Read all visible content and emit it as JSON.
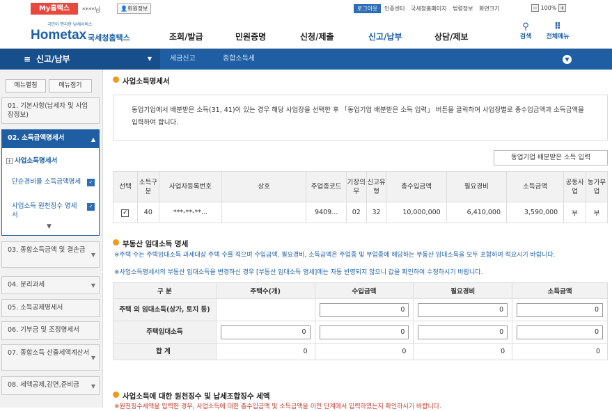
{
  "top": {
    "my_hometax": "My홈택스",
    "user_name": "****님",
    "user_info": "회원정보",
    "logout": "로그아웃",
    "links": [
      "인증센터",
      "국세청홈페이지",
      "법령정보",
      "화면크기"
    ],
    "zoom": "100%"
  },
  "header": {
    "logo_small": "국민이 편리한 납세서비스",
    "logo_en": "Hometax",
    "logo_ko": "국세청홈택스",
    "nav": [
      "조회/발급",
      "민원증명",
      "신청/제출",
      "신고/납부",
      "상담/제보"
    ],
    "search": "검색",
    "all_menu": "전체메뉴"
  },
  "locbar": {
    "title": "신고/납부",
    "crumb1": "세금신고",
    "crumb2": "종합소득세"
  },
  "side": {
    "edit_btn": "메뉴펼침",
    "fold_btn": "메뉴접기",
    "items": [
      "01. 기본사항(납세자 및 사업장정보)",
      "02. 소득금액명세서",
      "03. 종합소득금액 및 결손금",
      "04. 분리과세",
      "05. 소득공제명세서",
      "06. 기부금 및 조정명세서",
      "07. 종합소득 산출세액계산서",
      "08. 세액공제,감면,준비금"
    ],
    "sub_title": "사업소득명세서",
    "sub_items": [
      "단순경비율 소득금액명세",
      "사업소득 원천징수 명세서"
    ]
  },
  "main": {
    "sec1_title": "사업소득명세서",
    "notice": "동업기업에서 배분받은 소득(31, 41)이 있는 경우 해당 사업장을 선택한 후 「동업기업 배분받은 소득 입력」 버튼을 클릭하여 사업장별로 총수입금액과 소득금액을 입력하여 합니다.",
    "input_btn": "동업기업 배분받은 소득 입력",
    "t1_headers": [
      "선택",
      "소득구분",
      "사업자등록번호",
      "상호",
      "주업종코드",
      "기장의무",
      "신고유형",
      "총수입금액",
      "필요경비",
      "소득금액",
      "공동사업",
      "농가부업"
    ],
    "t1_row": {
      "code": "40",
      "bizno": "***-**-**...",
      "name": "",
      "industry": "9409...",
      "duty": "02",
      "type": "32",
      "revenue": "10,000,000",
      "expense": "6,410,000",
      "income": "3,590,000",
      "joint": "부",
      "farm": "부"
    },
    "sec2_title": "부동산 임대소득 명세",
    "note1": "※주택 수는 주택임대소득 과세대상 주택 수를 적으며 수입금액, 필요경비, 소득금액은 주업종 및 부업종에 해당하는 부동산 임대소득을 모두 포함하여 적요시기 바랍니다.",
    "note2": "※사업소득명세서의 부동산 임대소득을 변경하신 경우 [부동산 임대소득 명세]에는 자동 반영되지 않으니 값을 확인하여 수정하시기 바랍니다.",
    "t2_headers": [
      "구 분",
      "주택수(개)",
      "수입금액",
      "필요경비",
      "소득금액"
    ],
    "t2_rows": [
      {
        "label": "주택 외 임대소득(상가, 토지 등)",
        "houses": "",
        "rev": "0",
        "exp": "0",
        "inc": "0"
      },
      {
        "label": "주택임대소득",
        "houses": "0",
        "rev": "0",
        "exp": "0",
        "inc": "0"
      }
    ],
    "t2_sum": {
      "label": "합 계",
      "houses": "0",
      "rev": "0",
      "exp": "0",
      "inc": "0"
    },
    "sec3_title": "사업소득에 대한 원천징수 및 납세조합징수 세액",
    "note3": "※원천징수세액을 입력한 경우, 사업소득에 대한 총수입금액 및 소득금액을 이전 단계에서 입력하였는지 확인하시기 바랍니다."
  }
}
